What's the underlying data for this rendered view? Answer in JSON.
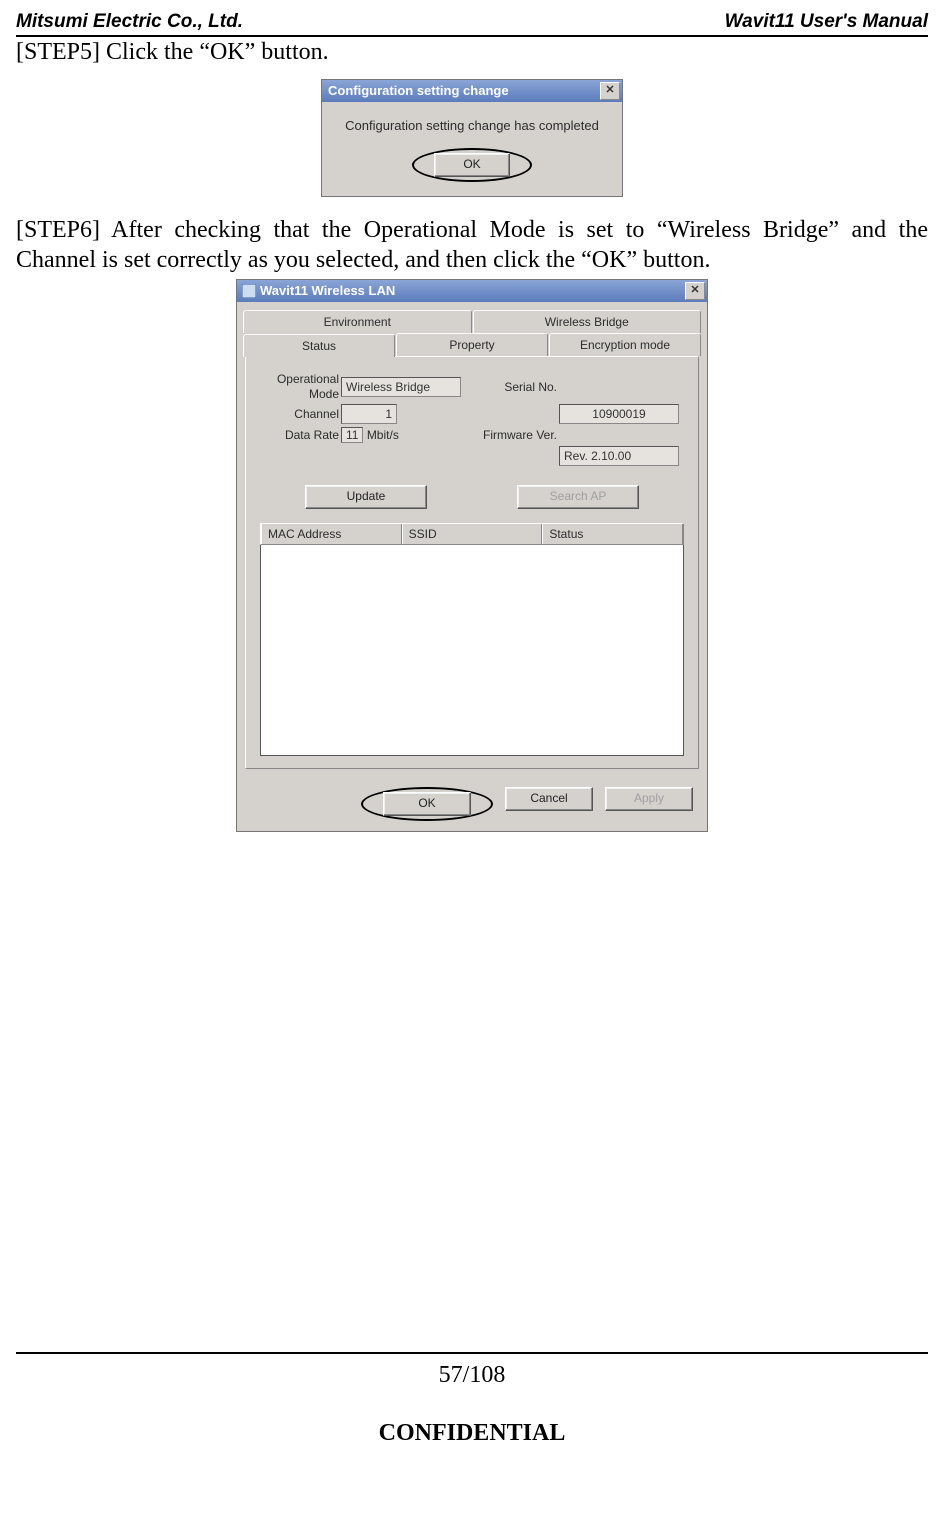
{
  "header": {
    "company": "Mitsumi Electric Co., Ltd.",
    "manual": "Wavit11 User's Manual"
  },
  "body": {
    "step5": "[STEP5] Click the “OK” button.",
    "step6": "[STEP6] After checking that the Operational Mode is set to “Wireless Bridge” and the Channel is set correctly as you selected, and then click the “OK” button."
  },
  "dialog1": {
    "title": "Configuration setting change",
    "message": "Configuration setting change has completed",
    "ok": "OK"
  },
  "dialog2": {
    "title": "Wavit11 Wireless LAN",
    "tabsTop": [
      "Environment",
      "Wireless Bridge"
    ],
    "tabsBottom": [
      "Status",
      "Property",
      "Encryption mode"
    ],
    "labels": {
      "opmode": "Operational\nMode",
      "channel": "Channel",
      "datarate": "Data Rate",
      "serial": "Serial No.",
      "firmware": "Firmware Ver."
    },
    "values": {
      "opmode": "Wireless Bridge",
      "channel": "1",
      "datarate": "11",
      "unit": "Mbit/s",
      "serial": "10900019",
      "firmware": "Rev. 2.10.00"
    },
    "buttons": {
      "update": "Update",
      "searchap": "Search AP",
      "ok": "OK",
      "cancel": "Cancel",
      "apply": "Apply"
    },
    "columns": [
      "MAC Address",
      "SSID",
      "Status"
    ]
  },
  "footer": {
    "page": "57/108",
    "confidential": "CONFIDENTIAL"
  }
}
